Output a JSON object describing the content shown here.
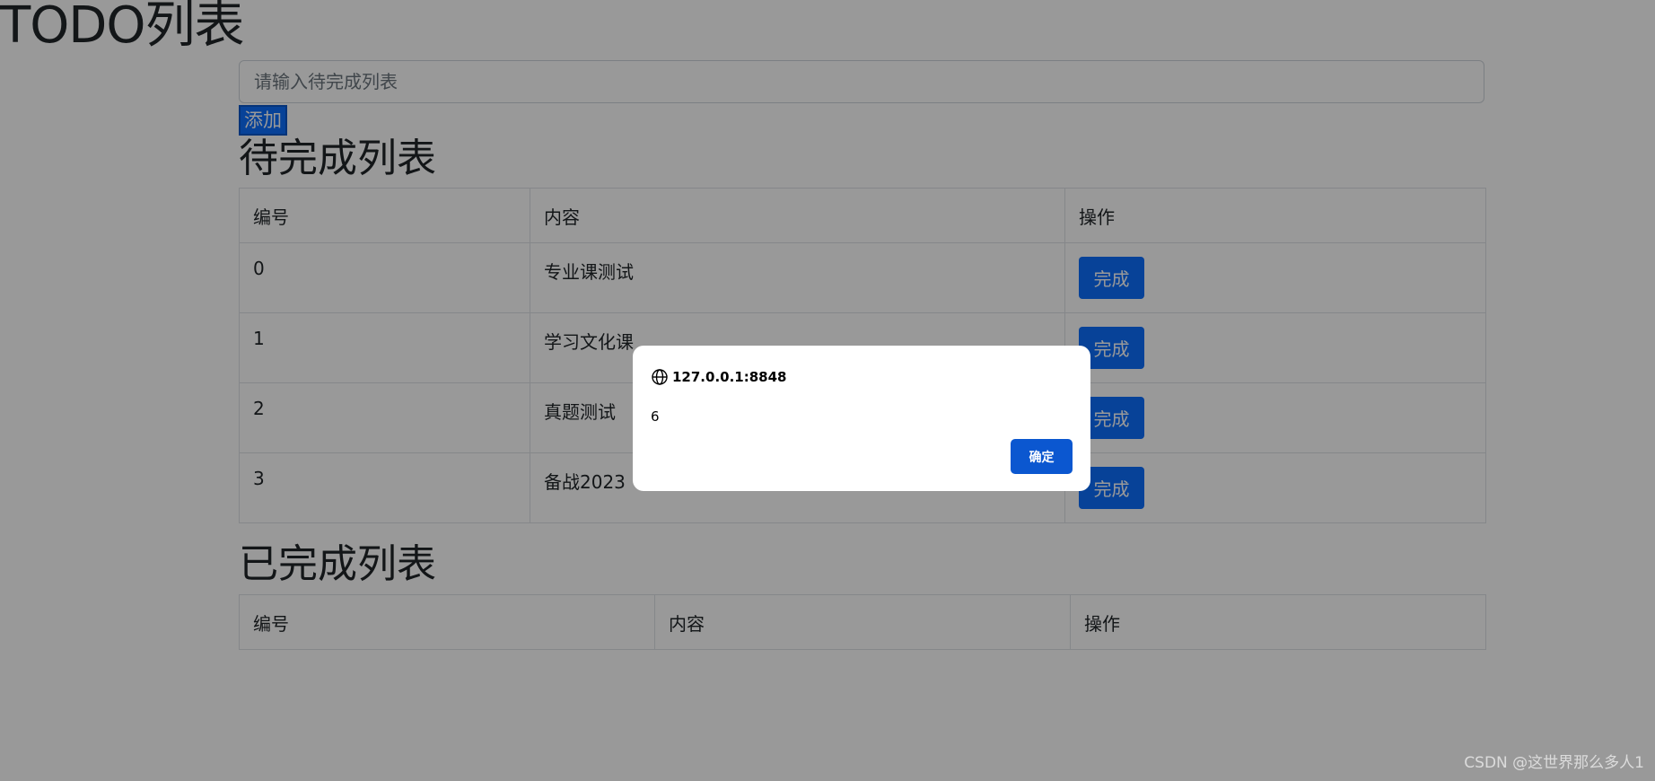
{
  "page": {
    "title": "TODO列表",
    "input_placeholder": "请输入待完成列表",
    "add_label": "添加"
  },
  "pending": {
    "title": "待完成列表",
    "headers": [
      "编号",
      "内容",
      "操作"
    ],
    "rows": [
      {
        "id": "0",
        "content": "专业课测试",
        "action": "完成"
      },
      {
        "id": "1",
        "content": "学习文化课",
        "action": "完成"
      },
      {
        "id": "2",
        "content": "真题测试",
        "action": "完成"
      },
      {
        "id": "3",
        "content": "备战2023",
        "action": "完成"
      }
    ]
  },
  "done": {
    "title": "已完成列表",
    "headers": [
      "编号",
      "内容",
      "操作"
    ]
  },
  "dialog": {
    "origin": "127.0.0.1:8848",
    "message": "6",
    "ok_label": "确定"
  },
  "watermark": "CSDN @这世界那么多人1",
  "colors": {
    "primary": "#0d6efd",
    "dialog_button": "#0b57d0",
    "overlay": "rgba(0,0,0,0.4)"
  }
}
